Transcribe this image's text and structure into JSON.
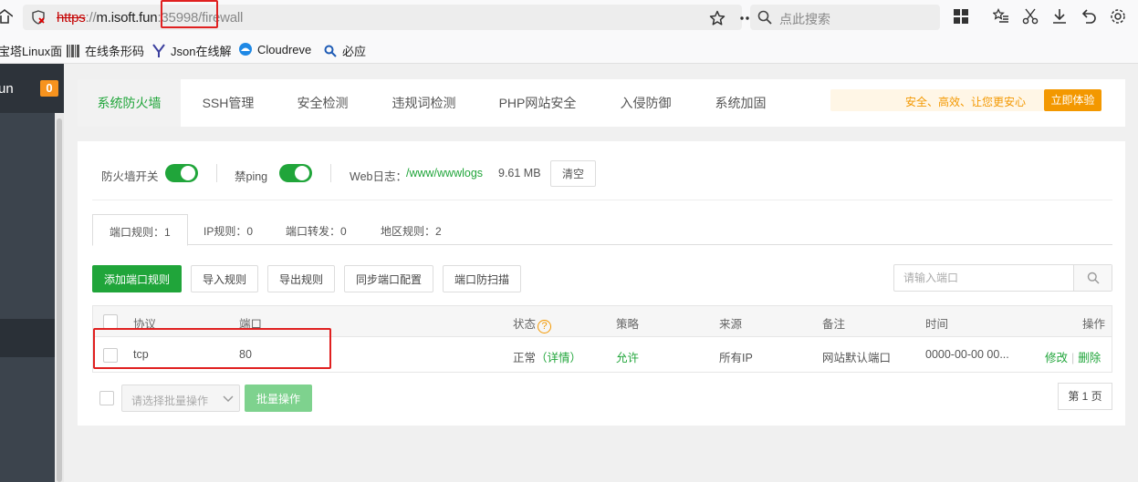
{
  "browser": {
    "url": {
      "proto": "https",
      "sep": "://",
      "host": "m.isoft.fun",
      "colon": ":",
      "port": "35998",
      "path": "/firewall"
    },
    "search_placeholder": "点此搜索"
  },
  "bookmarks": [
    {
      "label": "宝塔Linux面"
    },
    {
      "label": "在线条形码"
    },
    {
      "label": "Json在线解"
    },
    {
      "label": "Cloudreve"
    },
    {
      "label": "必应"
    }
  ],
  "sidebar": {
    "title": "un",
    "badge": "0"
  },
  "tabs": [
    "系统防火墙",
    "SSH管理",
    "安全检测",
    "违规词检测",
    "PHP网站安全",
    "入侵防御",
    "系统加固"
  ],
  "promo": {
    "text": "安全、高效、让您更安心",
    "button": "立即体验"
  },
  "switches": {
    "firewall_label": "防火墙开关",
    "ping_label": "禁ping",
    "weblog_label": "Web日志：",
    "weblog_path": "/www/wwwlogs",
    "weblog_size": "9.61 MB",
    "clear_label": "清空"
  },
  "subtabs": [
    "端口规则：1",
    "IP规则：0",
    "端口转发：0",
    "地区规则：2"
  ],
  "actions": {
    "add": "添加端口规则",
    "import": "导入规则",
    "export": "导出规则",
    "sync": "同步端口配置",
    "scan": "端口防扫描",
    "search_placeholder": "请输入端口"
  },
  "table": {
    "headers": {
      "protocol": "协议",
      "port": "端口",
      "status": "状态",
      "policy": "策略",
      "source": "来源",
      "remark": "备注",
      "time": "时间",
      "ops": "操作"
    },
    "rows": [
      {
        "protocol": "tcp",
        "port": "80",
        "status": "正常",
        "detail": "（详情）",
        "policy": "允许",
        "source": "所有IP",
        "remark": "网站默认端口",
        "time": "0000-00-00 00...",
        "edit": "修改",
        "delete": "删除"
      }
    ]
  },
  "batch": {
    "select_placeholder": "请选择批量操作",
    "button": "批量操作"
  },
  "pagination": {
    "label": "第 1 页"
  },
  "colors": {
    "accent": "#20a53a",
    "orange": "#f39800",
    "sidebar": "#3c444d"
  }
}
